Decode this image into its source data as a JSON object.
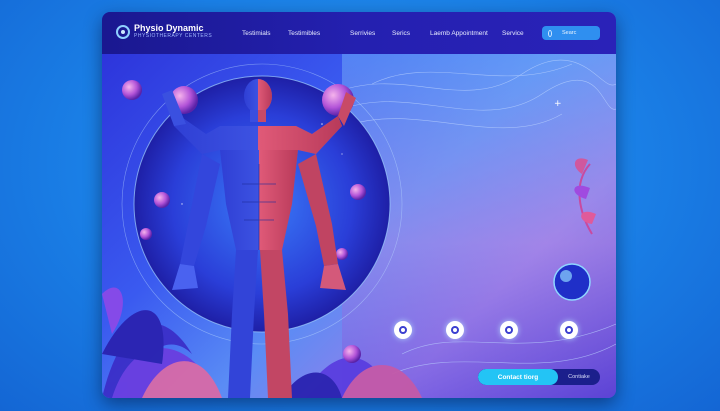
{
  "brand": {
    "title": "Physio Dynamic",
    "subtitle": "PHYSIOTHERAPY CENTERS"
  },
  "nav": [
    "Testimials",
    "Testimibles",
    "Serrivies",
    "Serics",
    "Laemb Appointment",
    "Service"
  ],
  "search": {
    "placeholder": "Searc"
  },
  "cta": {
    "primary": "Contact tiorg",
    "secondary": "Contiake"
  },
  "service_icons": [
    "massage-icon",
    "rehab-icon",
    "equipment-icon",
    "therapy-icon"
  ],
  "colors": {
    "topbar": "#1f1ca8",
    "accent": "#23c4f5",
    "muscle_red": "#d8455a",
    "muscle_blue": "#3a56e8"
  }
}
